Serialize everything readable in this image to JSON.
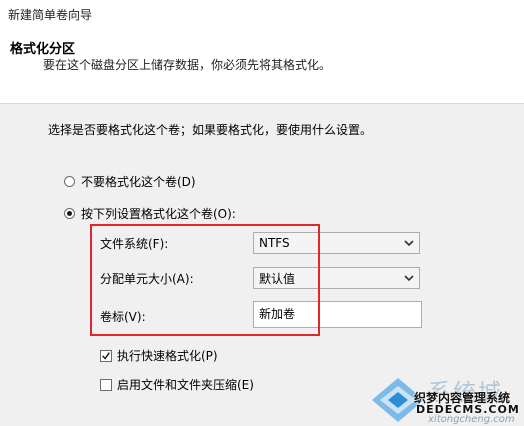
{
  "window": {
    "title": "新建简单卷向导"
  },
  "header": {
    "title": "格式化分区",
    "subtitle": "要在这个磁盘分区上储存数据，你必须先将其格式化。"
  },
  "prompt": "选择是否要格式化这个卷；如果要格式化，要使用什么设置。",
  "options": {
    "no_format": {
      "label": "不要格式化这个卷(D)",
      "selected": false
    },
    "format": {
      "label": "按下列设置格式化这个卷(O):",
      "selected": true
    }
  },
  "fields": {
    "file_system": {
      "label": "文件系统(F):",
      "value": "NTFS"
    },
    "allocation_unit": {
      "label": "分配单元大小(A):",
      "value": "默认值"
    },
    "volume_label": {
      "label": "卷标(V):",
      "value": "新加卷"
    }
  },
  "checkboxes": {
    "quick_format": {
      "label": "执行快速格式化(P)",
      "checked": true
    },
    "compression": {
      "label": "启用文件和文件夹压缩(E)",
      "checked": false
    }
  },
  "highlight_color": "#e0262e",
  "watermark": {
    "big_text": "系统城",
    "line1": "织梦内容管理系统",
    "line2": "DEDECMS.COM",
    "line3": "xitongcheng.com"
  }
}
